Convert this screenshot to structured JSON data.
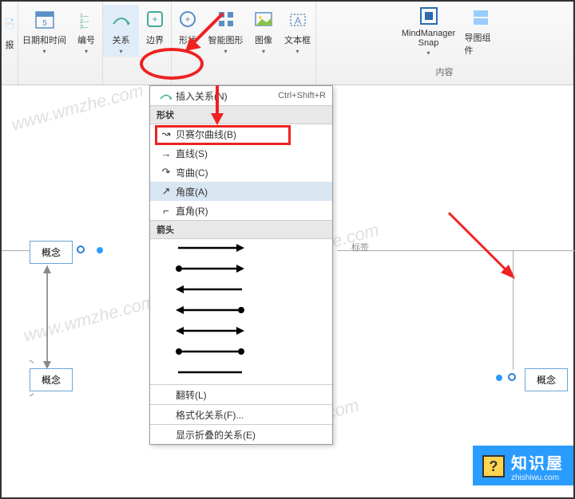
{
  "ribbon": {
    "btns": [
      {
        "label": "报"
      },
      {
        "label": "日期和时间"
      },
      {
        "label": "编号"
      },
      {
        "label": "关系"
      },
      {
        "label": "边界"
      },
      {
        "label": "形状"
      },
      {
        "label": "智能图形"
      },
      {
        "label": "图像"
      },
      {
        "label": "文本框"
      },
      {
        "label": "MindManager Snap"
      },
      {
        "label": "导图组件"
      }
    ],
    "section_label": "内容"
  },
  "dropdown": {
    "insert_relation": "插入关系(N)",
    "insert_shortcut": "Ctrl+Shift+R",
    "section_shape": "形状",
    "section_arrow": "箭头",
    "items": [
      {
        "icon": "↝",
        "label": "贝赛尔曲线(B)"
      },
      {
        "icon": "→",
        "label": "直线(S)"
      },
      {
        "icon": "↷",
        "label": "弯曲(C)"
      },
      {
        "icon": "↗",
        "label": "角度(A)"
      },
      {
        "icon": "⌐",
        "label": "直角(R)"
      }
    ],
    "flip": "翻转(L)",
    "format": "格式化关系(F)...",
    "show_collapsed": "显示折叠的关系(E)"
  },
  "canvas": {
    "nodes": [
      {
        "label": "概念"
      },
      {
        "label": "概念"
      },
      {
        "label": "概念"
      }
    ],
    "edge_label": "标签"
  },
  "annotation": {
    "brand_title": "知识屋",
    "brand_url": "zhishiwu.com",
    "watermark": "www.wmzhe.com"
  }
}
